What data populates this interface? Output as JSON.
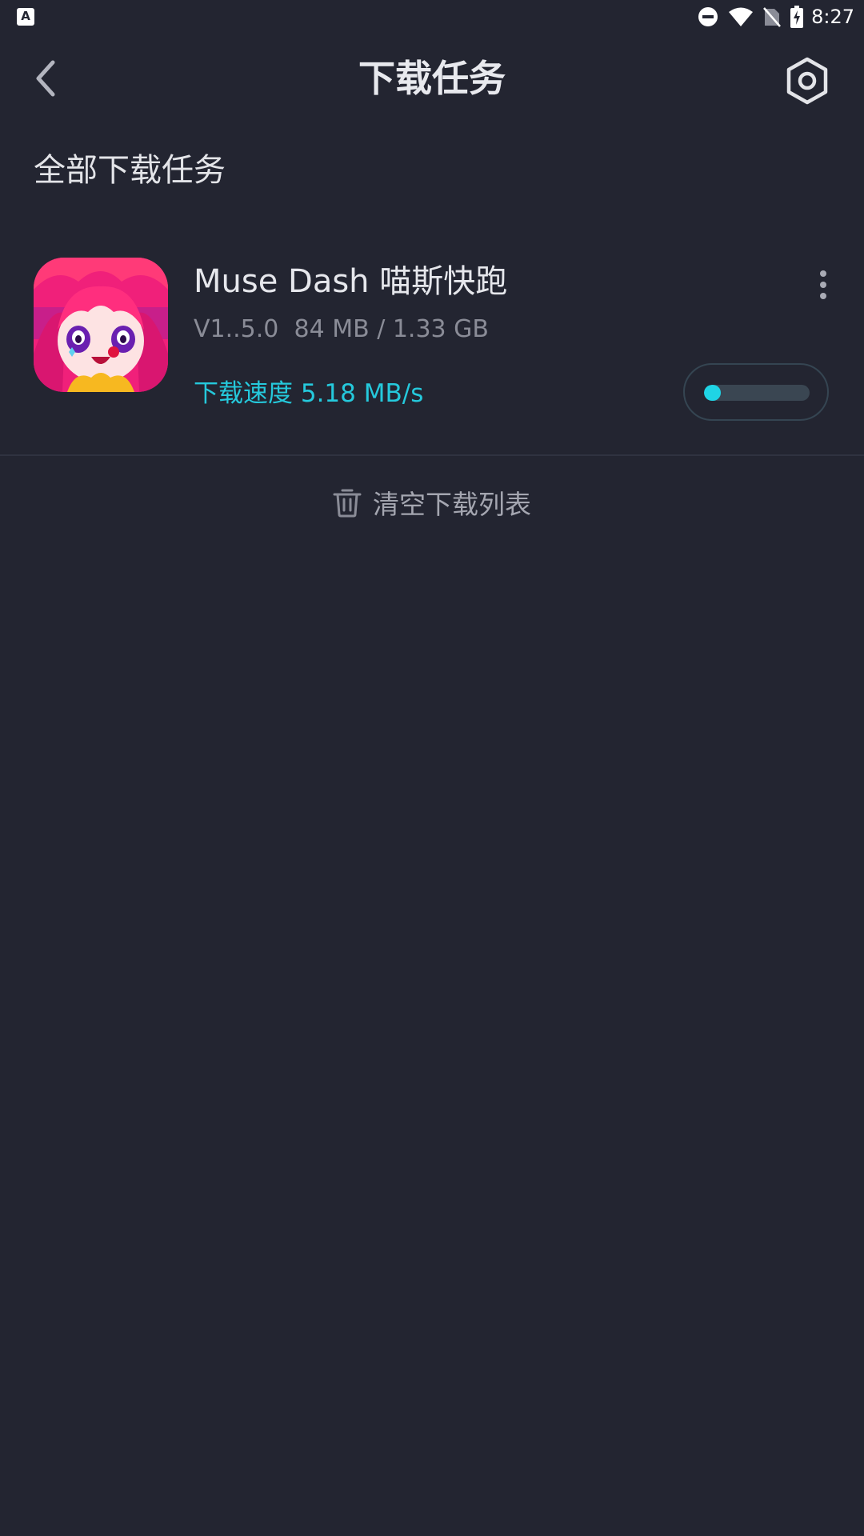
{
  "status_bar": {
    "notification_icon": "a-letter-icon",
    "notification_letter": "A",
    "time": "8:27",
    "icons": [
      "do-not-disturb-icon",
      "wifi-icon",
      "no-sim-icon",
      "battery-charging-icon"
    ]
  },
  "header": {
    "title": "下载任务",
    "back_icon": "chevron-left-icon",
    "settings_icon": "hexagon-settings-icon"
  },
  "section": {
    "title": "全部下载任务"
  },
  "tasks": [
    {
      "name": "Muse Dash 喵斯快跑",
      "version": "V1..5.0",
      "downloaded": "84 MB / 1.33 GB",
      "speed": "下载速度 5.18 MB/s",
      "progress": 0.063
    }
  ],
  "actions": {
    "clear_label": "清空下载列表"
  },
  "colors": {
    "background": "#232531",
    "accent": "#1fd4e5",
    "text_primary": "#e6e7ec",
    "text_secondary": "#8a8c97"
  }
}
